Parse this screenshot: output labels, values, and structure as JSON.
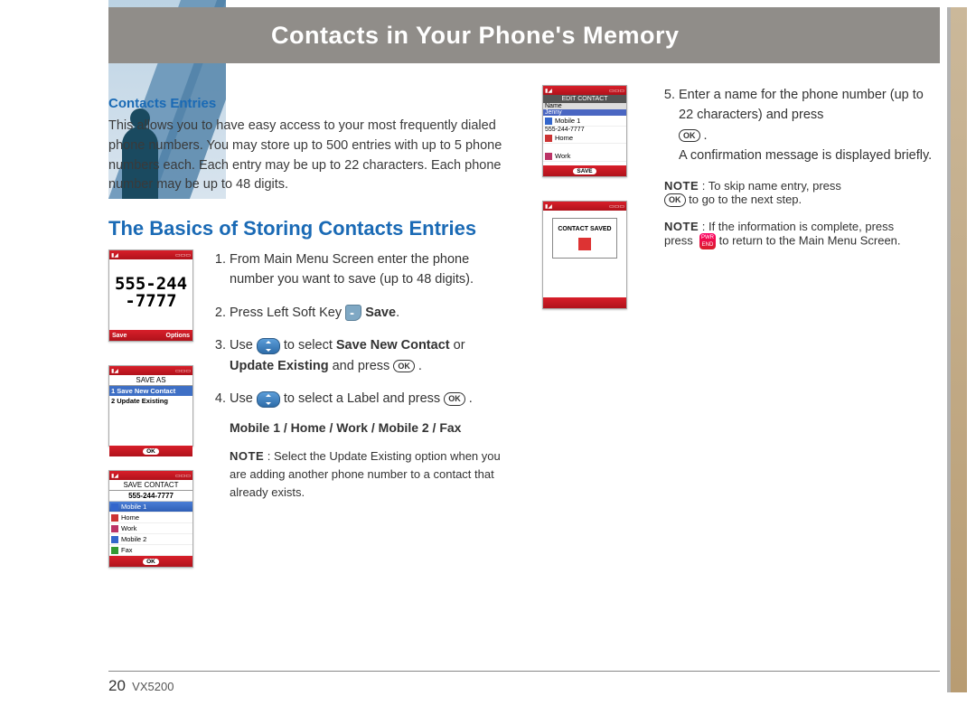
{
  "header": {
    "title": "Contacts in Your Phone's Memory"
  },
  "col1": {
    "sub_head": "Contacts Entries",
    "intro": "This allows you to have easy access to your most frequently dialed phone numbers. You may store up to 500 entries with up to 5 phone numbers each. Each entry may be up to 22 characters. Each phone number may be up to 48 digits.",
    "section_title": "The Basics of Storing Contacts Entries",
    "steps": {
      "s1": "From Main Menu Screen enter the phone number you want to save (up to 48 digits).",
      "s2a": "Press Left Soft Key ",
      "s2b": "Save",
      "s3a": "Use ",
      "s3b": " to select ",
      "s3c": "Save New Contact",
      "s3d": " or ",
      "s3e": "Update Existing",
      "s3f": " and press ",
      "s4a": "Use ",
      "s4b": " to select a Label and press "
    },
    "labels_line": "Mobile 1 / Home / Work / Mobile 2 / Fax",
    "note_label": "NOTE",
    "note1": " : Select the Update Existing option when you are adding another phone number to a contact that already exists."
  },
  "col3": {
    "s5a": "Enter a name for the phone number (up to 22 characters) and press ",
    "s5b": "A confirmation message is displayed briefly.",
    "note_label": "NOTE",
    "note2a": " : To skip name entry, press ",
    "note2b": " to go to the next step.",
    "note3a": " : If the information is complete, press ",
    "note3b": " to return to the Main Menu Screen."
  },
  "thumbs": {
    "t1": {
      "big_number": "555-244\n-7777",
      "left": "Save",
      "right": "Options"
    },
    "t2": {
      "title": "SAVE AS",
      "r1": "1  Save New Contact",
      "r2": "2  Update Existing",
      "center": "OK"
    },
    "t3": {
      "title": "SAVE CONTACT",
      "num": "555-244-7777",
      "labels": [
        "Mobile 1",
        "Home",
        "Work",
        "Mobile 2",
        "Fax"
      ],
      "center": "OK"
    },
    "t4": {
      "title": "EDIT CONTACT",
      "name_label": "Name",
      "name": "Jenny",
      "m1_label": "Mobile 1",
      "m1": "555-244-7777",
      "home_label": "Home",
      "work_label": "Work",
      "center": "SAVE"
    },
    "t5": {
      "msg": "CONTACT SAVED"
    }
  },
  "footer": {
    "page": "20",
    "model": "VX5200"
  }
}
